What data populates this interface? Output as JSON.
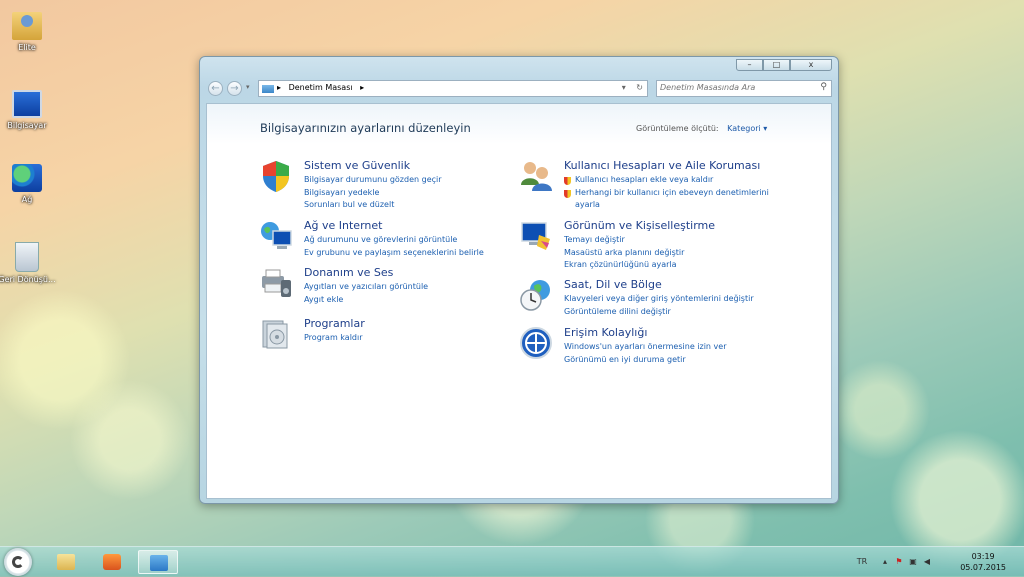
{
  "desktop": {
    "icons": [
      {
        "label": "Elite",
        "icon": "user-folder-icon"
      },
      {
        "label": "Bilgisayar",
        "icon": "computer-icon"
      },
      {
        "label": "Ağ",
        "icon": "network-icon"
      },
      {
        "label": "Geri Dönüşü...",
        "icon": "recycle-bin-icon"
      }
    ]
  },
  "window": {
    "controls": {
      "minimize": "–",
      "maximize": "□",
      "close": "x"
    },
    "address": {
      "crumb": "Denetim Masası",
      "sep": "▸"
    },
    "search": {
      "placeholder": "Denetim Masasında Ara"
    },
    "heading": "Bilgisayarınızın ayarlarını düzenleyin",
    "view_by": {
      "label": "Görüntüleme ölçütü:",
      "value": "Kategori ▾"
    },
    "categories_left": [
      {
        "title": "Sistem ve Güvenlik",
        "icon": "shield-icon",
        "links": [
          "Bilgisayar durumunu gözden geçir",
          "Bilgisayarı yedekle",
          "Sorunları bul ve düzelt"
        ]
      },
      {
        "title": "Ağ ve Internet",
        "icon": "globe-network-icon",
        "links": [
          "Ağ durumunu ve görevlerini görüntüle",
          "Ev grubunu ve paylaşım seçeneklerini belirle"
        ]
      },
      {
        "title": "Donanım ve Ses",
        "icon": "printer-speaker-icon",
        "links": [
          "Aygıtları ve yazıcıları görüntüle",
          "Aygıt ekle"
        ]
      },
      {
        "title": "Programlar",
        "icon": "programs-icon",
        "links": [
          "Program kaldır"
        ]
      }
    ],
    "categories_right": [
      {
        "title": "Kullanıcı Hesapları ve Aile Koruması",
        "icon": "users-icon",
        "links": [
          "Kullanıcı hesapları ekle veya kaldır",
          "Herhangi bir kullanıcı için ebeveyn denetimlerini",
          "ayarla"
        ]
      },
      {
        "title": "Görünüm ve Kişiselleştirme",
        "icon": "monitor-paint-icon",
        "links": [
          "Temayı değiştir",
          "Masaüstü arka planını değiştir",
          "Ekran çözünürlüğünü ayarla"
        ]
      },
      {
        "title": "Saat, Dil ve Bölge",
        "icon": "clock-globe-icon",
        "links": [
          "Klavyeleri veya diğer giriş yöntemlerini değiştir",
          "Görüntüleme dilini değiştir"
        ]
      },
      {
        "title": "Erişim Kolaylığı",
        "icon": "accessibility-icon",
        "links": [
          "Windows'un ayarları önermesine izin ver",
          "Görünümü en iyi duruma getir"
        ]
      }
    ]
  },
  "taskbar": {
    "tray_lang": "TR",
    "time": "03:19",
    "date": "05.07.2015"
  }
}
